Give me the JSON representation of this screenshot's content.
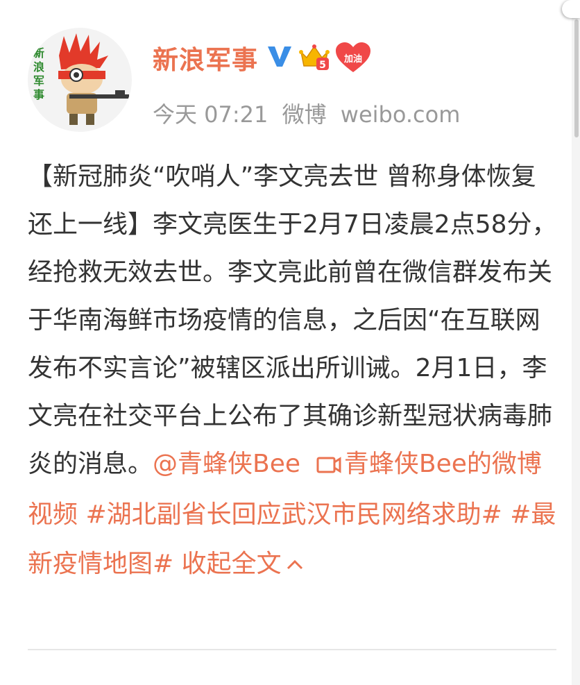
{
  "post": {
    "username": "新浪军事",
    "badge_label": "加油",
    "crown_level": "5",
    "avatar_text": "新浪军事",
    "time": "今天 07:21",
    "source_label": "微博",
    "source_domain": "weibo.com",
    "text_main": "【新冠肺炎“吹哨人”李文亮去世 曾称身体恢复还上一线】李文亮医生于2月7日凌晨2点58分，经抢救无效去世。李文亮此前曾在微信群发布关于华南海鲜市场疫情的信息，之后因“在互联网发布不实言论”被辖区派出所训诫。2月1日，李文亮在社交平台上公布了其确诊新型冠状病毒肺炎的消息。",
    "mention": "@青蜂侠Bee",
    "video_link": "青蜂侠Bee的微博视频",
    "topic1": "#湖北副省长回应武汉市民网络求助#",
    "topic2": "#最新疫情地图#",
    "collapse": "收起全文"
  },
  "colors": {
    "link": "#eb7350",
    "text": "#333333",
    "meta": "#999999",
    "vip_blue": "#3a8ee6",
    "heart_red": "#f04848"
  },
  "icons": {
    "vip": "verified-v-icon",
    "crown": "crown-icon",
    "heart": "heart-badge-icon",
    "video": "video-icon",
    "collapse": "chevron-up-icon"
  }
}
